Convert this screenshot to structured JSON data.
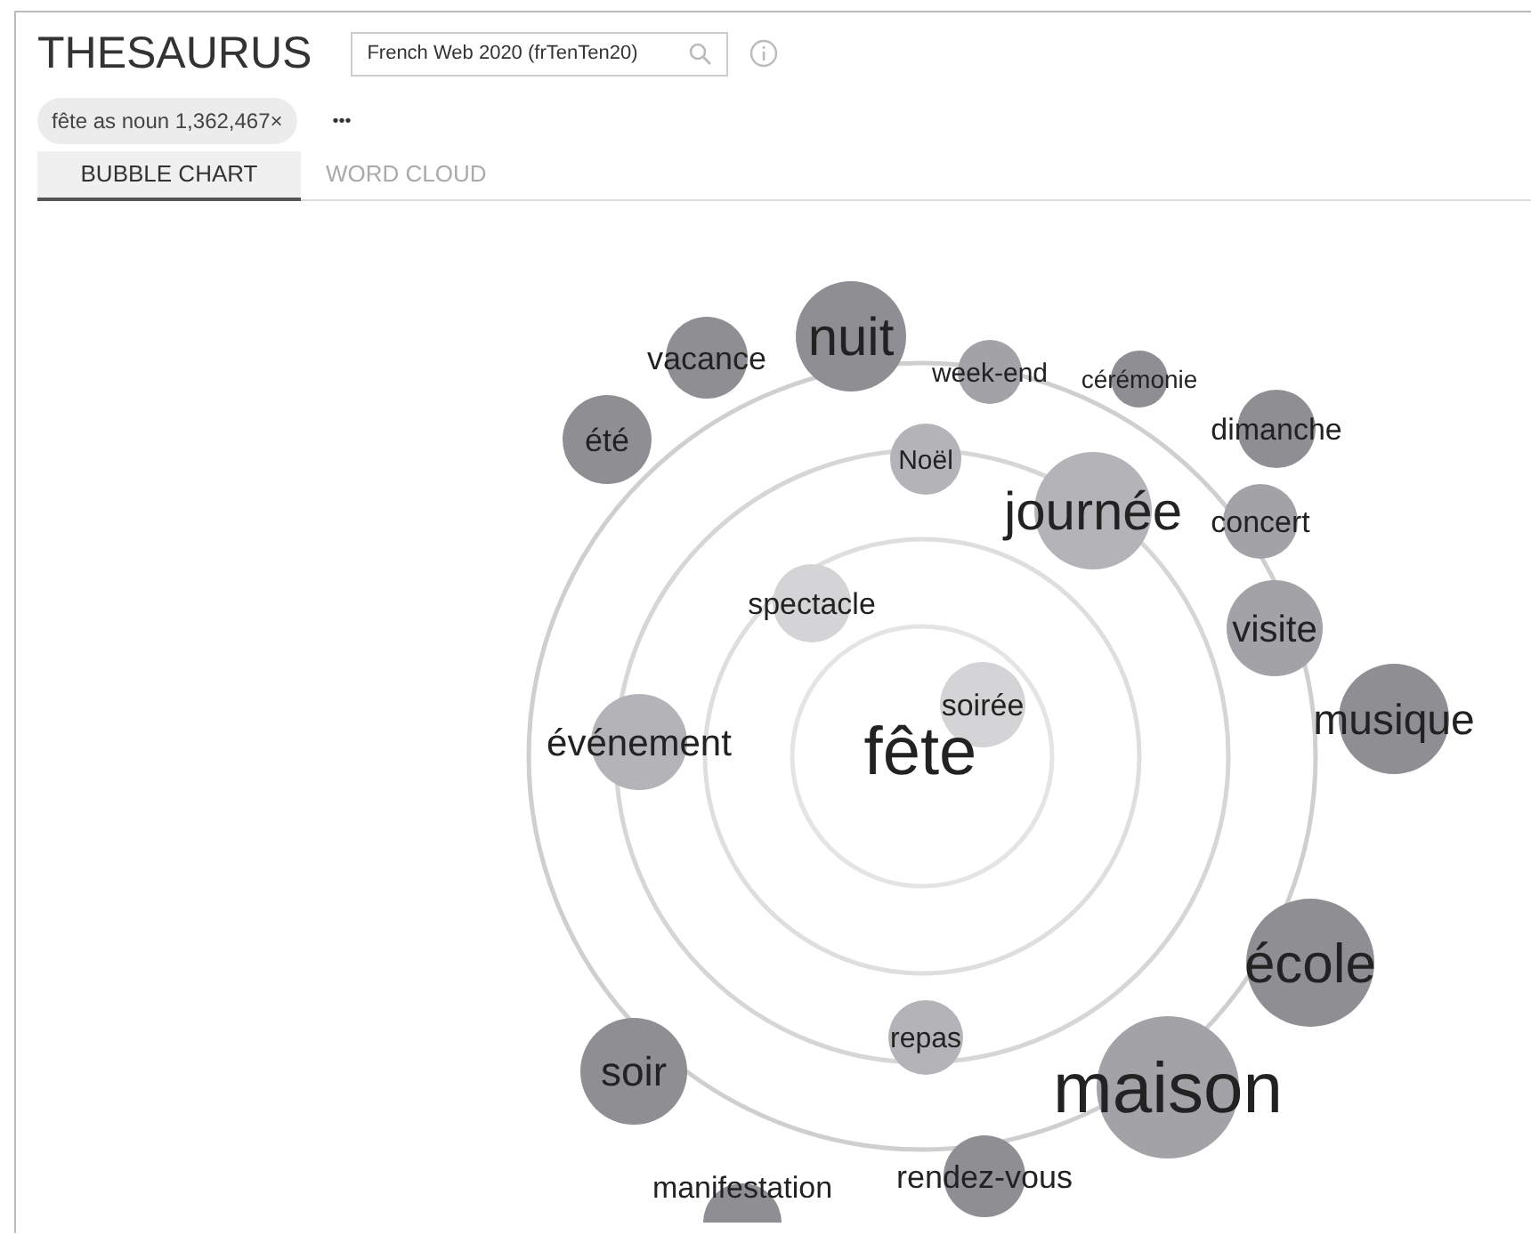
{
  "header": {
    "title": "THESAURUS",
    "corpus_field": {
      "value": "French Web 2020 (frTenTen20)"
    }
  },
  "query_chip": {
    "label": "fête as noun 1,362,467×"
  },
  "more_menu": "•••",
  "tabs": [
    {
      "label": "BUBBLE CHART",
      "selected": true
    },
    {
      "label": "WORD CLOUD",
      "selected": false
    }
  ],
  "bubble_chart": {
    "center_word": "fête",
    "words": [
      {
        "word": "nuit",
        "color": "#8e8e93"
      },
      {
        "word": "vacance",
        "color": "#8e8e93"
      },
      {
        "word": "été",
        "color": "#8e8e93"
      },
      {
        "word": "week-end",
        "color": "#a2a2a7"
      },
      {
        "word": "cérémonie",
        "color": "#8e8e93"
      },
      {
        "word": "dimanche",
        "color": "#8e8e93"
      },
      {
        "word": "Noël",
        "color": "#b4b4b8"
      },
      {
        "word": "journée",
        "color": "#b4b4b8"
      },
      {
        "word": "concert",
        "color": "#a2a2a7"
      },
      {
        "word": "spectacle",
        "color": "#d4d4d6"
      },
      {
        "word": "visite",
        "color": "#a2a2a7"
      },
      {
        "word": "musique",
        "color": "#8e8e93"
      },
      {
        "word": "soirée",
        "color": "#d4d4d6"
      },
      {
        "word": "événement",
        "color": "#b4b4b8"
      },
      {
        "word": "école",
        "color": "#8e8e93"
      },
      {
        "word": "repas",
        "color": "#b4b4b8"
      },
      {
        "word": "soir",
        "color": "#8e8e93"
      },
      {
        "word": "maison",
        "color": "#a2a2a7"
      },
      {
        "word": "manifestation",
        "color": "#8e8e93"
      },
      {
        "word": "rendez-vous",
        "color": "#8e8e93"
      }
    ]
  }
}
